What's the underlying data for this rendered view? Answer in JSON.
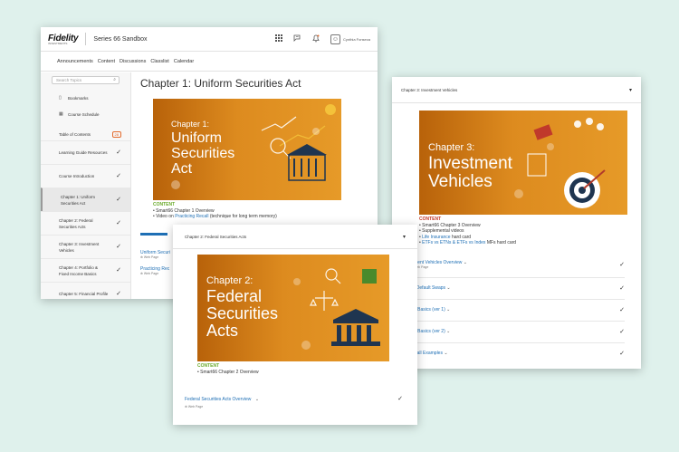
{
  "colors": {
    "accent_orange": "#e36a2c",
    "content_green": "#6aaa2a",
    "link_blue": "#1e6fb5",
    "background": "#dff1ec"
  },
  "window1": {
    "logo": "Fidelity",
    "logo_sub": "INVESTMENTS",
    "course_title": "Series 66 Sandbox",
    "icons": [
      "grid-icon",
      "chat-icon",
      "bell-icon",
      "user-icon"
    ],
    "user_name": "Cynthia Fonseca",
    "nav": [
      "Announcements",
      "Content",
      "Discussions",
      "Classlist",
      "Calendar"
    ],
    "search_placeholder": "Search Topics",
    "sidebar_links": [
      {
        "label": "Bookmarks",
        "icon": "bookmark-icon"
      },
      {
        "label": "Course Schedule",
        "icon": "calendar-icon"
      }
    ],
    "toc_label": "Table of Contents",
    "toc_count": "28",
    "chapters": [
      {
        "label": "Learning Guide Resources"
      },
      {
        "label": "Course Introduction"
      },
      {
        "label": "Chapter 1: Uniform Securities Act"
      },
      {
        "label": "Chapter 2: Federal Securities Acts"
      },
      {
        "label": "Chapter 3: Investment Vehicles"
      },
      {
        "label": "Chapter 4: Portfolio & Fixed Income Basics"
      },
      {
        "label": "Chapter 5: Financial Profile"
      }
    ],
    "heading": "Chapter 1: Uniform Securities Act",
    "banner_line1": "Chapter 1:",
    "banner_line2": "Uniform",
    "banner_line3": "Securities",
    "banner_line4": "Act",
    "content_label": "CONTENT",
    "bullet1": "Smart66 Chapter 1 Overview",
    "bullet2_pre": "Video on ",
    "bullet2_link": "Practicing Recall",
    "bullet2_post": " (technique for long term memory)",
    "rows": [
      {
        "title": "Uniform Securi",
        "type": "Web Page"
      },
      {
        "title": "Practicing Rec",
        "type": "Web Page"
      }
    ]
  },
  "window3": {
    "header": "Chapter 3: Investment Vehicles",
    "banner_line1": "Chapter 3:",
    "banner_line2": "Investment",
    "banner_line3": "Vehicles",
    "content_label": "CONTENT",
    "bullets": [
      {
        "pre": "",
        "link": "",
        "text": "Smart66 Chapter 3 Overview"
      },
      {
        "pre": "",
        "link": "",
        "text": "Supplemental videos"
      },
      {
        "pre": "",
        "link": "Life Insurance",
        "text": " hard card"
      },
      {
        "pre": "",
        "link": "ETFs vs ETNs & ETFs vs Index",
        "text": " MFs hard card"
      }
    ],
    "rows": [
      {
        "title": "ment Vehicles Overview",
        "type": "Web Page"
      },
      {
        "title": "t Default Swaps",
        "type": ""
      },
      {
        "title": "n Basics (ver 1)",
        "type": ""
      },
      {
        "title": "n Basics (ver 2)",
        "type": ""
      },
      {
        "title": "Call Examples",
        "type": ""
      }
    ]
  },
  "window2": {
    "header": "Chapter 2: Federal Securities Acts",
    "banner_line1": "Chapter 2:",
    "banner_line2": "Federal",
    "banner_line3": "Securities",
    "banner_line4": "Acts",
    "content_label": "CONTENT",
    "bullet1": "Smart66 Chapter 2 Overview",
    "row_title": "Federal Securities Acts Overview",
    "row_type": "Web Page"
  }
}
